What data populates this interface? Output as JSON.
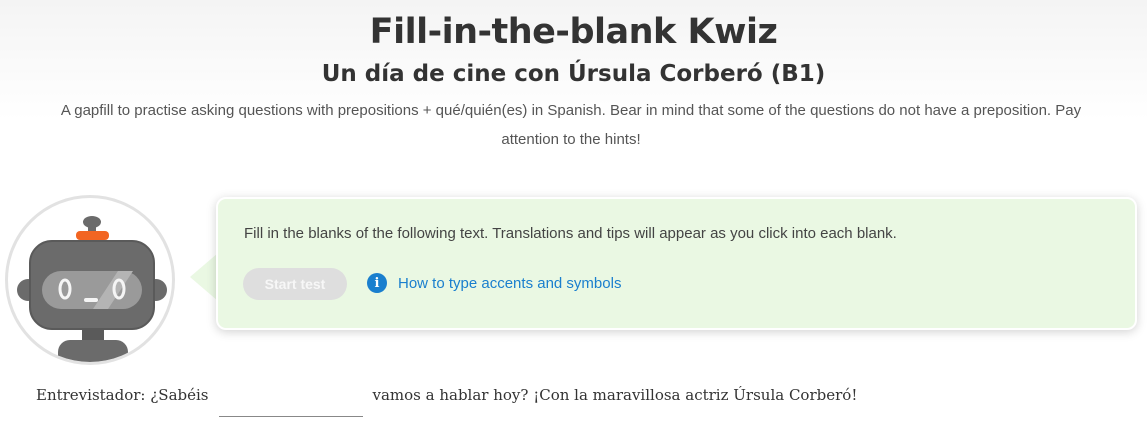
{
  "header": {
    "title": "Fill-in-the-blank Kwiz",
    "subtitle": "Un día de cine con Úrsula Corberó (B1)",
    "description": "A gapfill to practise asking questions with prepositions + qué/quién(es) in Spanish. Bear in mind that some of the questions do not have a preposition. Pay attention to the hints!"
  },
  "card": {
    "instructions": "Fill in the blanks of the following text. Translations and tips will appear as you click into each blank.",
    "start_label": "Start test",
    "accents_link_label": "How to type accents and symbols",
    "info_icon_glyph": "i"
  },
  "exercise": {
    "line_prefix": "Entrevistador: ¿Sabéis",
    "blank_value": "",
    "line_suffix": "vamos a hablar hoy? ¡Con la maravillosa actriz Úrsula Corberó!"
  },
  "colors": {
    "card_bg": "#eaf8e3",
    "link": "#1a7fce",
    "robot_accent": "#f26522",
    "robot_body": "#6b6b6b"
  },
  "icons": {
    "robot": "robot-mascot-icon",
    "info": "info-circle-icon"
  }
}
